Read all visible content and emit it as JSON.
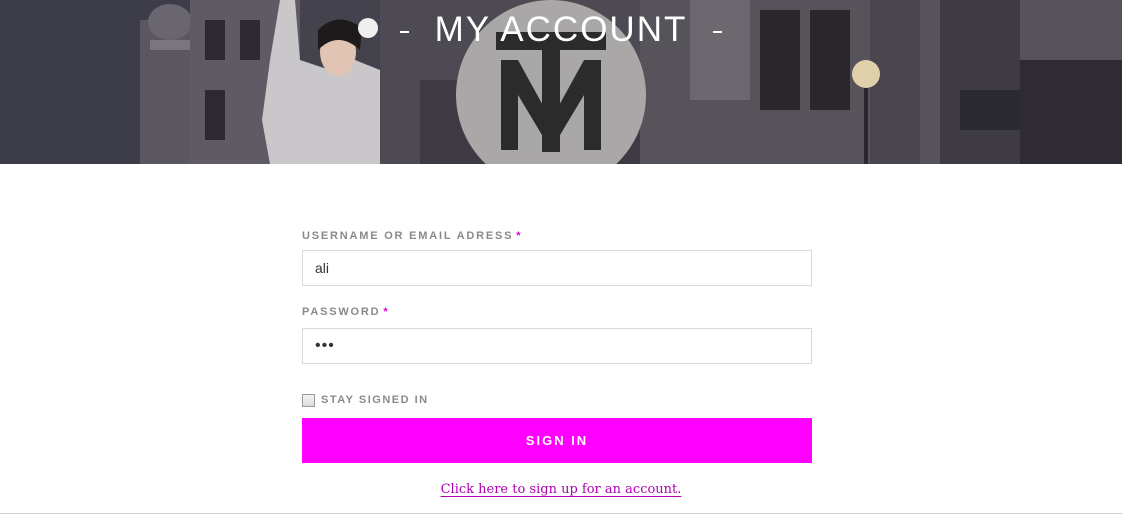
{
  "header": {
    "title": "MY ACCOUNT"
  },
  "login_form": {
    "username_label": "USERNAME OR EMAIL ADRESS",
    "username_required": "*",
    "username_value": "ali",
    "password_label": "PASSWORD",
    "password_required": "*",
    "password_value": "•••",
    "stay_signed_in_label": "STAY SIGNED IN",
    "stay_signed_in_checked": false,
    "submit_label": "SIGN IN",
    "signup_link": "Click here to sign up for an account."
  },
  "colors": {
    "accent": "#ff00ff",
    "link": "#b000b0",
    "required": "#e000e0"
  }
}
